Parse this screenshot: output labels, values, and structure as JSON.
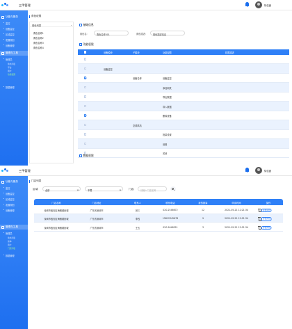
{
  "app": {
    "title": "三甲管理",
    "user": "徐佳鑫"
  },
  "colors": {
    "primary": "#2f80f7",
    "sidebar": "#1e6ff0",
    "row_alt": "#eaf2fe"
  },
  "sidebar": {
    "sections": [
      {
        "label": "功能与服务",
        "items": [
          "监控",
          "设备监控",
          "区域监控",
          "发展规划",
          "设备管理"
        ]
      },
      {
        "label": "管理与工具",
        "items": [
          "管理员",
          "系统设置"
        ]
      }
    ],
    "sub_items_top": [
      "角色列表",
      "平台",
      "用户",
      "功能权限"
    ],
    "sub_items_bottom": [
      "角色列表",
      "菜单",
      "用户",
      "门店列表"
    ],
    "extra": "数据管理"
  },
  "screen1": {
    "breadcrumb": "角色权限",
    "tree": {
      "header": "角色列表",
      "nodes": [
        "角色名称1",
        "角色名称2",
        "角色名称3",
        "角色名称4"
      ]
    },
    "info": {
      "title": "基础信息",
      "name_label": "角色名:",
      "name_value": "角色名称001",
      "desc_label": "角色描述:",
      "desc_value": "角色描述信息"
    },
    "perm": {
      "title": "功能权限",
      "headers": [
        "",
        "设备模块",
        "子模块",
        "功能权限",
        "权限描述"
      ],
      "rows": [
        {
          "module": "",
          "sub": "",
          "perm": "",
          "checked": false
        },
        {
          "module": "设备监控",
          "sub": "",
          "perm": "",
          "checked": false
        },
        {
          "module": "",
          "sub": "设备名称",
          "perm": "设备监控",
          "checked": true
        },
        {
          "module": "",
          "sub": "",
          "perm": "添加网关",
          "checked": false
        },
        {
          "module": "",
          "sub": "",
          "perm": "导出数据",
          "checked": false
        },
        {
          "module": "",
          "sub": "",
          "perm": "导入数据",
          "checked": false
        },
        {
          "module": "",
          "sub": "",
          "perm": "删除设备",
          "checked": true
        },
        {
          "module": "",
          "sub": "空调风机",
          "perm": "",
          "checked": false
        },
        {
          "module": "",
          "sub": "",
          "perm": "批量设置",
          "checked": false
        },
        {
          "module": "",
          "sub": "",
          "perm": "设置",
          "checked": false
        },
        {
          "module": "",
          "sub": "",
          "perm": "关闭",
          "checked": false
        }
      ]
    },
    "data_perm": {
      "title": "数据权限"
    }
  },
  "screen2": {
    "breadcrumb": "门店列表",
    "filters": {
      "region_label": "区域:",
      "region_value": "全部",
      "type_value": "不限",
      "store_label": "门店:",
      "store_placeholder": "请输入门店名称"
    },
    "table": {
      "headers": [
        "门店名称",
        "门店地址",
        "联系人",
        "联系电话",
        "我的数量",
        "申请时间",
        "操作"
      ],
      "rows": [
        [
          "深圳市宝安区海雅缤纷城",
          "广东省深圳市",
          "张三",
          "020-2546672",
          "12",
          "2021-05-21 12:21:34"
        ],
        [
          "深圳市宝安区海雅缤纷城",
          "广东省深圳市",
          "李四",
          "15812345678",
          "9",
          "2021-05-21 12:21:34"
        ],
        [
          "深圳市宝安区海雅缤纷城",
          "广东省深圳市",
          "王五",
          "020-2648521",
          "3",
          "2021-05-21 12:21:34"
        ]
      ],
      "edit_label": "查看详情"
    }
  }
}
